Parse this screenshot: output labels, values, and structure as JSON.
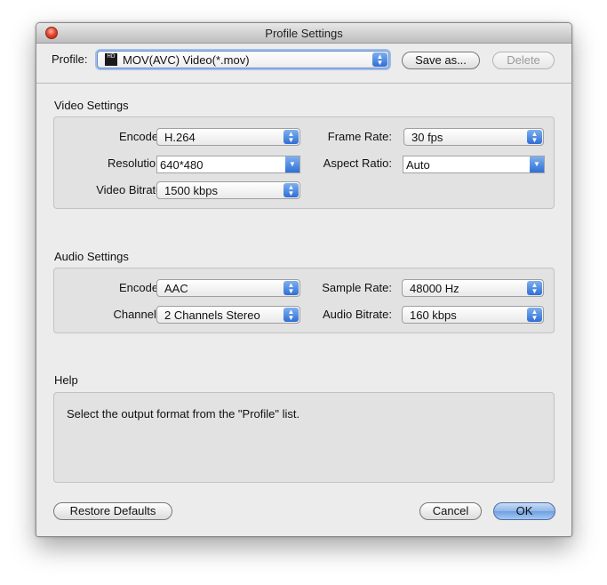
{
  "window": {
    "title": "Profile Settings"
  },
  "toolbar": {
    "profile_label": "Profile:",
    "profile_value": "MOV(AVC) Video(*.mov)",
    "profile_icon_text": "HD",
    "save_as_label": "Save as...",
    "delete_label": "Delete"
  },
  "video": {
    "section_title": "Video Settings",
    "encoder_label": "Encoder:",
    "encoder_value": "H.264",
    "frame_rate_label": "Frame Rate:",
    "frame_rate_value": "30 fps",
    "resolution_label": "Resolution:",
    "resolution_value": "640*480",
    "aspect_ratio_label": "Aspect Ratio:",
    "aspect_ratio_value": "Auto",
    "bitrate_label": "Video Bitrate:",
    "bitrate_value": "1500 kbps"
  },
  "audio": {
    "section_title": "Audio Settings",
    "encoder_label": "Encoder:",
    "encoder_value": "AAC",
    "sample_rate_label": "Sample Rate:",
    "sample_rate_value": "48000 Hz",
    "channels_label": "Channels:",
    "channels_value": "2 Channels Stereo",
    "bitrate_label": "Audio Bitrate:",
    "bitrate_value": "160 kbps"
  },
  "help": {
    "section_title": "Help",
    "text": "Select the output format from the \"Profile\" list."
  },
  "footer": {
    "restore_label": "Restore Defaults",
    "cancel_label": "Cancel",
    "ok_label": "OK"
  },
  "colors": {
    "accent_blue": "#2f6fd6",
    "close_red": "#e8492f",
    "window_bg": "#ececec"
  }
}
